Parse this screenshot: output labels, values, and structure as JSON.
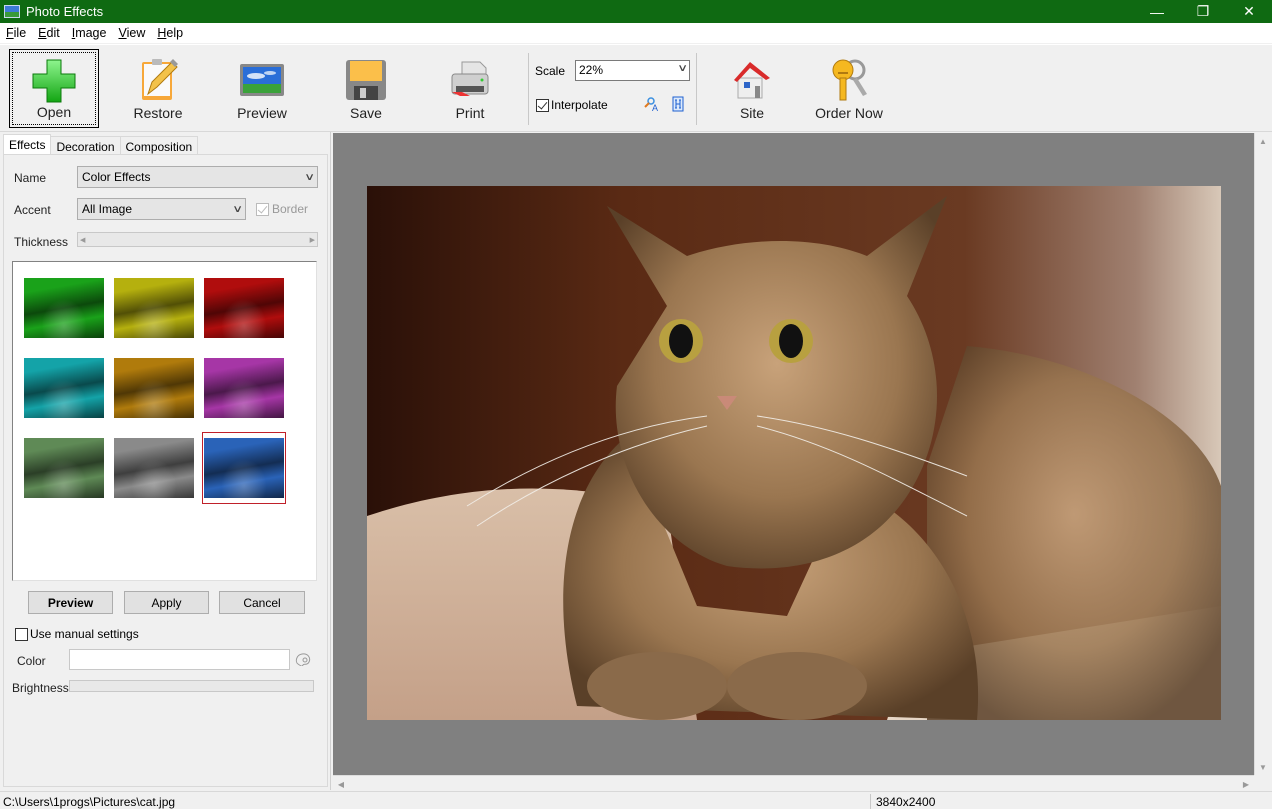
{
  "window": {
    "title": "Photo Effects",
    "controls": {
      "minimize": "—",
      "restore": "❐",
      "close": "✕"
    }
  },
  "menu": [
    {
      "label": "File",
      "accel": "F",
      "rest": "ile"
    },
    {
      "label": "Edit",
      "accel": "E",
      "rest": "dit"
    },
    {
      "label": "Image",
      "accel": "I",
      "rest": "mage"
    },
    {
      "label": "View",
      "accel": "V",
      "rest": "iew"
    },
    {
      "label": "Help",
      "accel": "H",
      "rest": "elp"
    }
  ],
  "toolbar": {
    "open": "Open",
    "restore": "Restore",
    "preview": "Preview",
    "save": "Save",
    "print": "Print",
    "scale_label": "Scale",
    "scale_value": "22%",
    "interpolate_label": "Interpolate",
    "interpolate_checked": true,
    "site": "Site",
    "order_now": "Order Now"
  },
  "tabs": [
    "Effects",
    "Decoration",
    "Composition"
  ],
  "active_tab": "Effects",
  "effects": {
    "name_label": "Name",
    "name_value": "Color Effects",
    "accent_label": "Accent",
    "accent_value": "All Image",
    "border_label": "Border",
    "border_checked": true,
    "border_disabled": true,
    "thickness_label": "Thickness",
    "thumbnails": [
      {
        "tint": "green",
        "color": "#1aa21a",
        "selected": false
      },
      {
        "tint": "yellow",
        "color": "#b5b00e",
        "selected": false
      },
      {
        "tint": "red",
        "color": "#b00d0d",
        "selected": false
      },
      {
        "tint": "cyan",
        "color": "#14a3a8",
        "selected": false
      },
      {
        "tint": "orange",
        "color": "#b07b0c",
        "selected": false
      },
      {
        "tint": "magenta",
        "color": "#a636a6",
        "selected": false
      },
      {
        "tint": "sage",
        "color": "#5f8a56",
        "selected": false
      },
      {
        "tint": "grayscale",
        "color": "#8a8a8a",
        "selected": false
      },
      {
        "tint": "blue",
        "color": "#2a63b8",
        "selected": true
      }
    ],
    "preview_btn": "Preview",
    "apply_btn": "Apply",
    "cancel_btn": "Cancel",
    "manual_label": "Use manual settings",
    "manual_checked": false,
    "color_label": "Color",
    "color_value": "",
    "brightness_label": "Brightness"
  },
  "status": {
    "path": "C:\\Users\\1progs\\Pictures\\cat.jpg",
    "dimensions": "3840x2400"
  }
}
